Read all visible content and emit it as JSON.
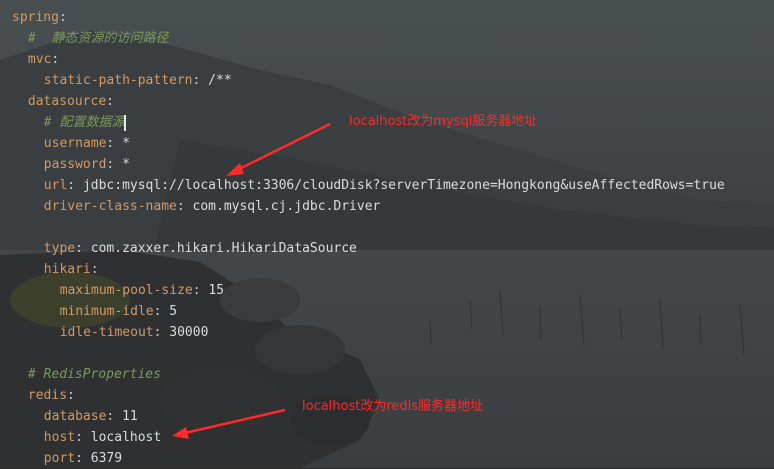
{
  "editor": {
    "lines": [
      {
        "indent": 0,
        "key": "spring",
        "sep": ":",
        "value": ""
      },
      {
        "indent": 2,
        "comment": "#  静态资源的访问路径"
      },
      {
        "indent": 2,
        "key": "mvc",
        "sep": ":",
        "value": ""
      },
      {
        "indent": 4,
        "key": "static-path-pattern",
        "sep": ": ",
        "value": "/**"
      },
      {
        "indent": 2,
        "key": "datasource",
        "sep": ":",
        "value": ""
      },
      {
        "indent": 4,
        "comment": "# 配置数据源",
        "caret": true
      },
      {
        "indent": 4,
        "key": "username",
        "sep": ": ",
        "value": "*"
      },
      {
        "indent": 4,
        "key": "password",
        "sep": ": ",
        "value": "*"
      },
      {
        "indent": 4,
        "key": "url",
        "sep": ": ",
        "value": "jdbc:mysql://localhost:3306/cloudDisk?serverTimezone=Hongkong&useAffectedRows=true"
      },
      {
        "indent": 4,
        "key": "driver-class-name",
        "sep": ": ",
        "value": "com.mysql.cj.jdbc.Driver"
      },
      {
        "indent": 0,
        "blank": true
      },
      {
        "indent": 4,
        "key": "type",
        "sep": ": ",
        "value": "com.zaxxer.hikari.HikariDataSource"
      },
      {
        "indent": 4,
        "key": "hikari",
        "sep": ":",
        "value": ""
      },
      {
        "indent": 6,
        "key": "maximum-pool-size",
        "sep": ": ",
        "value": "15"
      },
      {
        "indent": 6,
        "key": "minimum-idle",
        "sep": ": ",
        "value": "5"
      },
      {
        "indent": 6,
        "key": "idle-timeout",
        "sep": ": ",
        "value": "30000"
      },
      {
        "indent": 0,
        "blank": true
      },
      {
        "indent": 2,
        "comment": "# RedisProperties"
      },
      {
        "indent": 2,
        "key": "redis",
        "sep": ":",
        "value": ""
      },
      {
        "indent": 4,
        "key": "database",
        "sep": ": ",
        "value": "11"
      },
      {
        "indent": 4,
        "key": "host",
        "sep": ": ",
        "value": "localhost"
      },
      {
        "indent": 4,
        "key": "port",
        "sep": ": ",
        "value": "6379"
      }
    ]
  },
  "annotations": {
    "mysql_note": "localhost改为mysql服务器地址",
    "redis_note": "localhost改为redis服务器地址"
  },
  "colors": {
    "key": "#d19a66",
    "comment": "#7a9a5a",
    "annotation": "#ff2a2a",
    "background": "#2b2b2b"
  }
}
